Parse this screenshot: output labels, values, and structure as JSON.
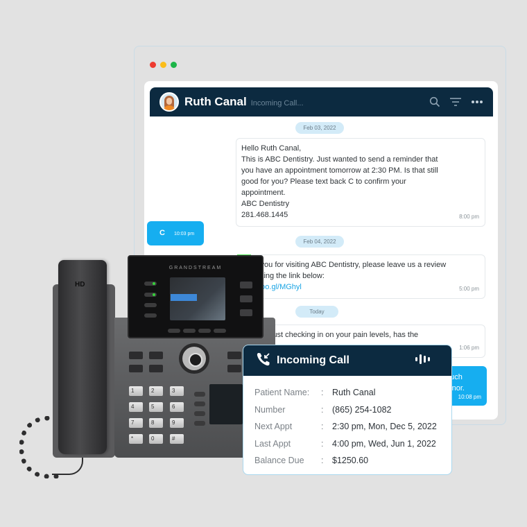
{
  "window": {
    "traffic_lights": [
      "close",
      "minimize",
      "maximize"
    ]
  },
  "chat": {
    "contact_name": "Ruth Canal",
    "contact_status": "Incoming Call...",
    "header_icons": [
      "search-icon",
      "filter-icon",
      "more-icon"
    ],
    "messages": [
      {
        "type": "date",
        "text": "Feb 03, 2022"
      },
      {
        "type": "incoming",
        "lines": [
          "Hello Ruth Canal,",
          "This is ABC Dentistry. Just wanted to send a reminder that",
          "you have an appointment tomorrow at 2:30 PM. Is that still",
          "good for you? Please text back C to confirm your",
          "appointment.",
          "ABC Dentistry",
          "281.468.1445"
        ],
        "time": "8:00 pm"
      },
      {
        "type": "outgoing",
        "text": "C",
        "time": "10:03 pm"
      },
      {
        "type": "date",
        "text": "Feb 04, 2022"
      },
      {
        "type": "incoming",
        "lines": [
          "k you for visiting ABC Dentistry, please leave us a review",
          "icking the link below:"
        ],
        "link": "/goo.gl/MGhyl",
        "time": "5:00 pm"
      },
      {
        "type": "date",
        "text": "Today"
      },
      {
        "type": "incoming",
        "lines": [
          "just checking in on your pain levels, has the"
        ],
        "time": "1:06 pm"
      },
      {
        "type": "outgoing",
        "lines": [
          "much",
          "minor."
        ],
        "time": "10:08 pm"
      }
    ]
  },
  "phone": {
    "brand": "GRANDSTREAM",
    "handset_label": "HD",
    "keypad": [
      "1",
      "2",
      "3",
      "4",
      "5",
      "6",
      "7",
      "8",
      "9",
      "*",
      "0",
      "#"
    ]
  },
  "incoming_call": {
    "title": "Incoming Call",
    "rows": [
      {
        "label": "Patient Name:",
        "value": "Ruth Canal"
      },
      {
        "label": "Number",
        "value": "(865) 254-1082"
      },
      {
        "label": "Next Appt",
        "value": "2:30 pm, Mon, Dec 5, 2022"
      },
      {
        "label": "Last Appt",
        "value": "4:00 pm, Wed, Jun 1, 2022"
      },
      {
        "label": "Balance Due",
        "value": "$1250.60"
      }
    ],
    "separator": ":"
  },
  "colors": {
    "header_bg": "#0c2a40",
    "accent_blue": "#16aef0",
    "date_pill": "#d3ebf8"
  }
}
